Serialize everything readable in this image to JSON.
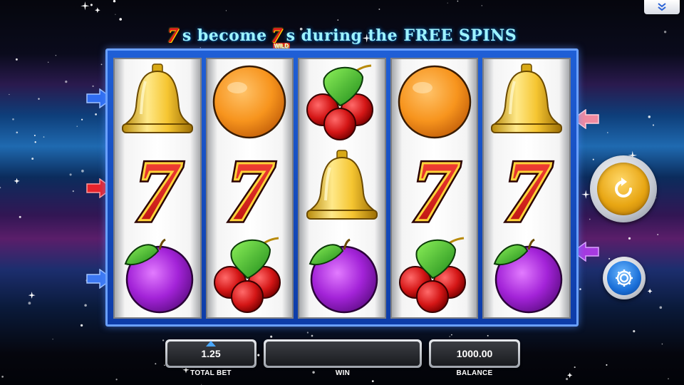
{
  "banner": {
    "seven_a": "7",
    "text_a": "s become",
    "seven_b": "7",
    "wild_label": "WILD",
    "text_b": "s during the FREE SPINS"
  },
  "reels": [
    [
      "bell",
      "seven",
      "plum"
    ],
    [
      "orange",
      "seven",
      "cherry"
    ],
    [
      "cherry",
      "bell",
      "plum"
    ],
    [
      "orange",
      "seven",
      "cherry"
    ],
    [
      "bell",
      "seven",
      "plum"
    ]
  ],
  "symbol_text": {
    "seven": "7"
  },
  "colors": {
    "payline_left_top": "#2f6df0",
    "payline_left_mid": "#e8232b",
    "payline_left_bot": "#3c78f2",
    "payline_right_top": "#f08aa0",
    "payline_right_bot": "#a63ae0",
    "frame": "#1f5fd6"
  },
  "controls": {
    "spin_icon": "refresh-icon",
    "settings_icon": "gear-icon",
    "collapse_icon": "chevron-double-down-icon"
  },
  "footer": {
    "total_bet_value": "1.25",
    "total_bet_label": "TOTAL BET",
    "win_value": "",
    "win_label": "WIN",
    "balance_value": "1000.00",
    "balance_label": "BALANCE"
  }
}
